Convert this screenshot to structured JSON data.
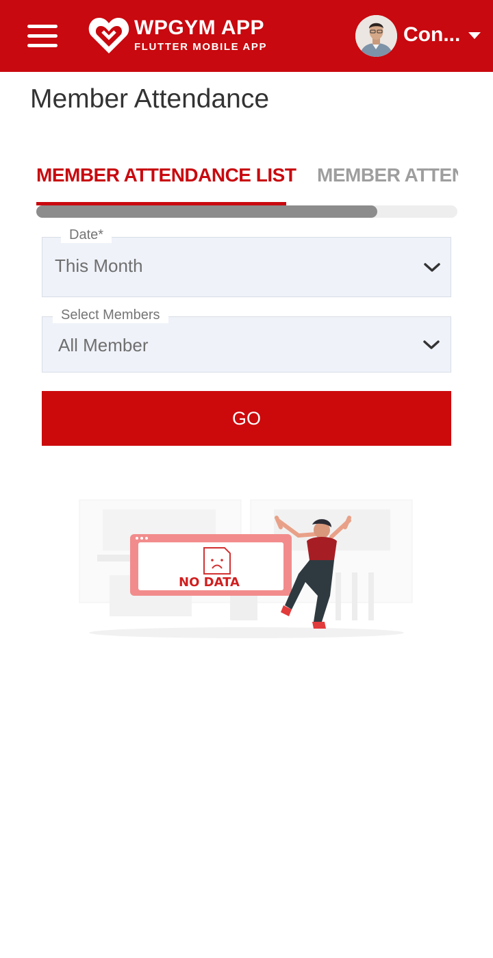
{
  "header": {
    "brand_title": "WPGYM APP",
    "brand_subtitle": "FLUTTER MOBILE APP",
    "user_name": "Con...",
    "icons": {
      "menu": "hamburger-menu-icon",
      "logo": "heart-logo-icon",
      "user_menu": "caret-down-icon"
    }
  },
  "page": {
    "title": "Member Attendance"
  },
  "tabs": [
    {
      "label": "MEMBER ATTENDANCE LIST",
      "active": true
    },
    {
      "label": "MEMBER ATTEN",
      "active": false
    }
  ],
  "form": {
    "date": {
      "label": "Date*",
      "value": "This Month"
    },
    "members": {
      "label": "Select Members",
      "value": "All Member"
    },
    "submit_label": "GO"
  },
  "empty_state": {
    "text": "NO DATA"
  },
  "colors": {
    "brand_red": "#c8090f",
    "field_bg": "#eff2f9",
    "inactive_tab": "#9e9e9e"
  }
}
